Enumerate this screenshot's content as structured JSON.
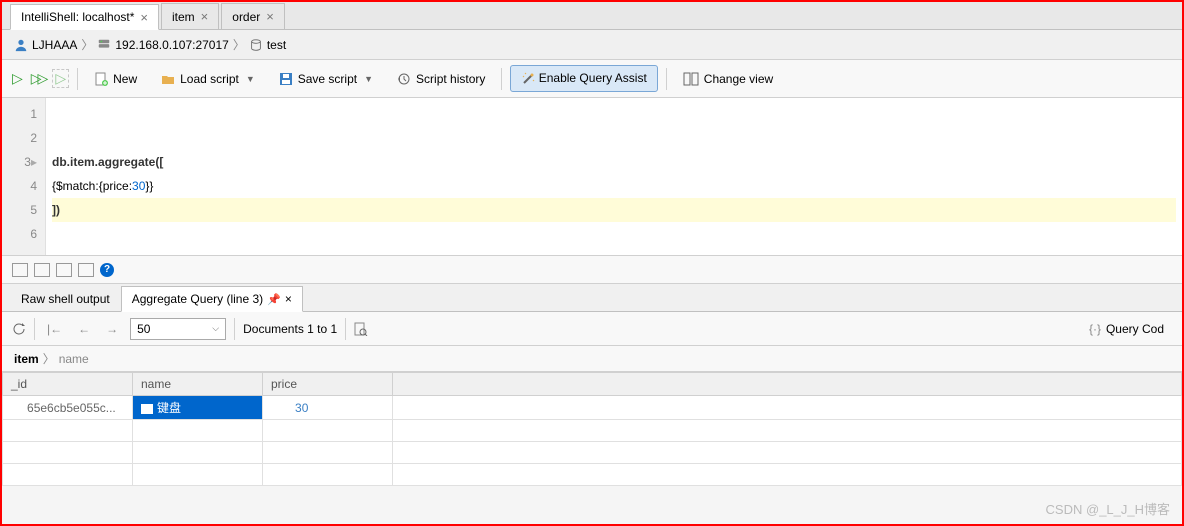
{
  "tabs": [
    {
      "label": "IntelliShell: localhost*",
      "active": true
    },
    {
      "label": "item",
      "active": false
    },
    {
      "label": "order",
      "active": false
    }
  ],
  "breadcrumb": {
    "user": "LJHAAA",
    "host": "192.168.0.107:27017",
    "db": "test"
  },
  "toolbar": {
    "new": "New",
    "load": "Load script",
    "save": "Save script",
    "history": "Script history",
    "assist": "Enable Query Assist",
    "view": "Change view"
  },
  "editor": {
    "lines": [
      "1",
      "2",
      "3",
      "4",
      "5",
      "6"
    ],
    "code": {
      "l3_a": "db.item.aggregate([",
      "l4_a": "  {$match:{price:",
      "l4_num": "30",
      "l4_b": "}}",
      "l5": "])"
    }
  },
  "result_tabs": {
    "raw": "Raw shell output",
    "agg": "Aggregate Query (line 3)"
  },
  "result_toolbar": {
    "limit": "50",
    "docs": "Documents 1 to 1",
    "querycode": "Query Cod"
  },
  "bc2": {
    "coll": "item",
    "field": "name"
  },
  "table": {
    "cols": [
      "_id",
      "name",
      "price"
    ],
    "row": {
      "id": "65e6cb5e055c...",
      "name": "键盘",
      "price": "30"
    }
  },
  "watermark": "CSDN @_L_J_H博客"
}
